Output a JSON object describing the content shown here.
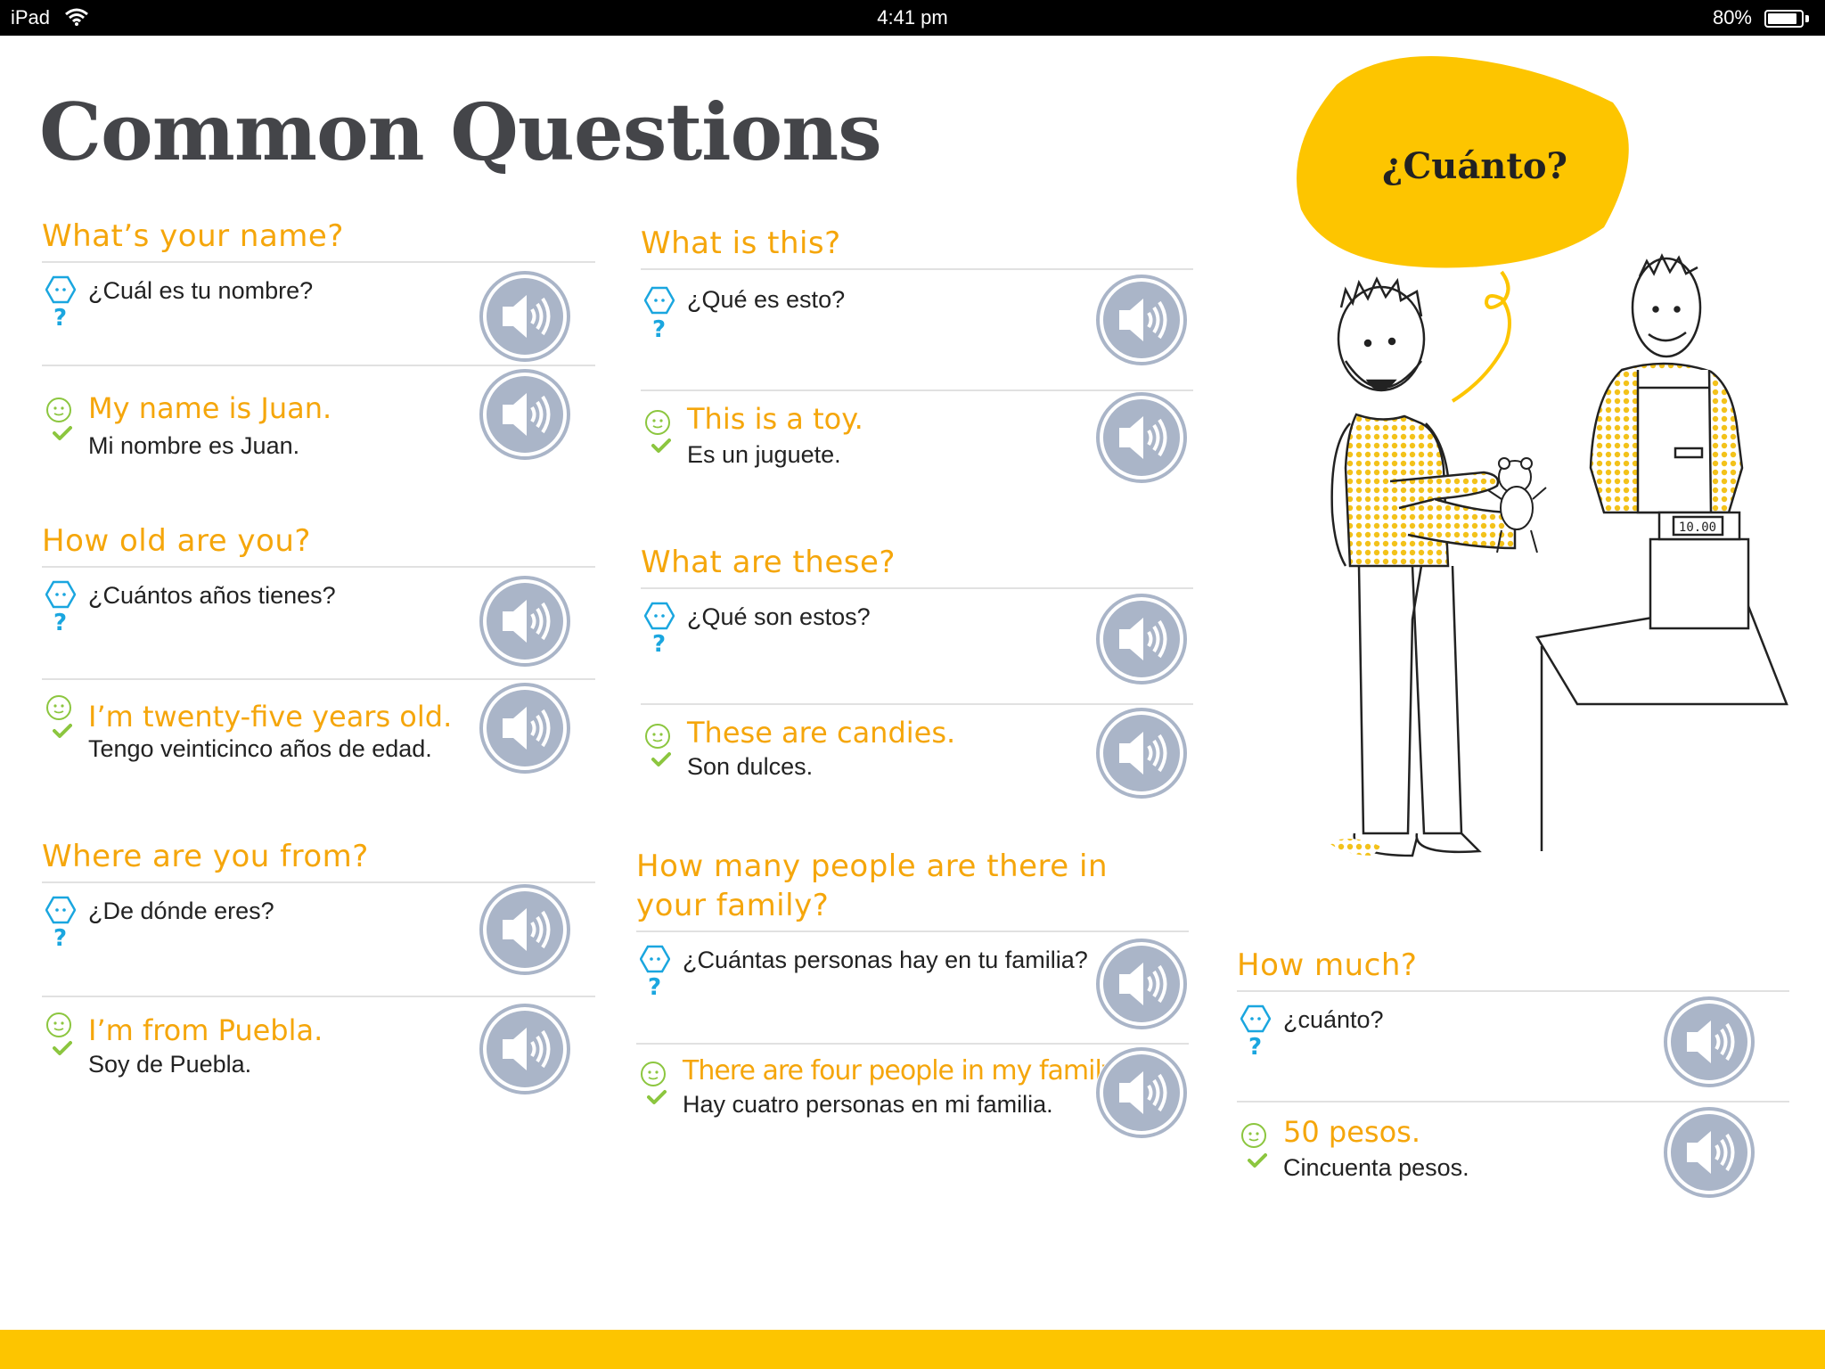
{
  "status_bar": {
    "device": "iPad",
    "time": "4:41 pm",
    "battery": "80%",
    "battery_level": 0.8
  },
  "page": {
    "title": "Common Questions"
  },
  "icons": {
    "question": "hexagon-face-icon",
    "answer": "smiley-icon",
    "check": "check-icon",
    "speaker": "speaker-icon"
  },
  "colors": {
    "accent": "#f5a60b",
    "question_icon": "#1aa6df",
    "answer_icon": "#8cc63f",
    "speaker": "#aab5c8",
    "footer": "#fdc500"
  },
  "sections": [
    {
      "title": "What’s your name?",
      "question": "¿Cuál es tu nombre?",
      "answer_en": "My name is Juan.",
      "answer_es": "Mi nombre es Juan."
    },
    {
      "title": "How old are you?",
      "question": "¿Cuántos años tienes?",
      "answer_en": "I’m twenty-five years old.",
      "answer_es": "Tengo veinticinco años de edad."
    },
    {
      "title": "Where are you from?",
      "question": "¿De dónde eres?",
      "answer_en": "I’m from Puebla.",
      "answer_es": "Soy de Puebla."
    },
    {
      "title": "What is this?",
      "question": "¿Qué es esto?",
      "answer_en": "This is a toy.",
      "answer_es": "Es un juguete."
    },
    {
      "title": "What are these?",
      "question": "¿Qué son estos?",
      "answer_en": "These are candies.",
      "answer_es": "Son dulces."
    },
    {
      "title": "How many people are there in your family?",
      "question": "¿Cuántas personas hay en tu familia?",
      "answer_en": "There are four people in my family.",
      "answer_es": "Hay cuatro personas en mi familia."
    },
    {
      "title": "How much?",
      "question": "¿cuánto?",
      "answer_en": "50 pesos.",
      "answer_es": "Cincuenta pesos."
    }
  ],
  "illustration": {
    "speech_bubble": "¿Cuánto?",
    "scale_display": "10.00"
  }
}
